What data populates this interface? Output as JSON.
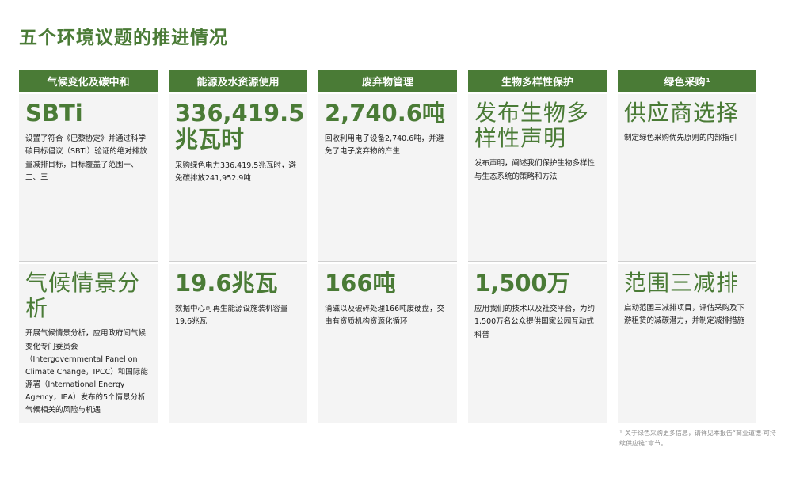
{
  "title": "五个环境议题的推进情况",
  "columns": [
    {
      "header": "气候变化及碳中和",
      "top": {
        "metric": "SBTi",
        "desc": "设置了符合《巴黎协定》并通过科学碳目标倡议（SBTi）验证的绝对排放量减排目标，目标覆盖了范围一、二、三"
      },
      "bottom": {
        "metric": "气候情景分析",
        "desc": "开展气候情景分析，应用政府间气候变化专门委员会（Intergovernmental Panel on Climate Change，IPCC）和国际能源署（International Energy Agency，IEA）发布的5个情景分析气候相关的风险与机遇"
      }
    },
    {
      "header": "能源及水资源使用",
      "top": {
        "metric": "336,419.5兆瓦时",
        "desc": "采购绿色电力336,419.5兆瓦时，避免碳排放241,952.9吨"
      },
      "bottom": {
        "metric": "19.6兆瓦",
        "desc": "数据中心可再生能源设施装机容量19.6兆瓦"
      }
    },
    {
      "header": "废弃物管理",
      "top": {
        "metric": "2,740.6吨",
        "desc": "回收利用电子设备2,740.6吨，并避免了电子废弃物的产生"
      },
      "bottom": {
        "metric": "166吨",
        "desc": "消磁以及破碎处理166吨废硬盘，交由有资质机构资源化循环"
      }
    },
    {
      "header": "生物多样性保护",
      "top": {
        "metric": "发布生物多样性声明",
        "desc": "发布声明，阐述我们保护生物多样性与生态系统的策略和方法"
      },
      "bottom": {
        "metric": "1,500万",
        "desc": "应用我们的技术以及社交平台，为约1,500万名公众提供国家公园互动式科普"
      }
    },
    {
      "header": "绿色采购",
      "header_sup": "1",
      "top": {
        "metric": "供应商选择",
        "desc": "制定绿色采购优先原则的内部指引"
      },
      "bottom": {
        "metric": "范围三减排",
        "desc": "启动范围三减排项目，评估采购及下游租赁的减碳潜力，并制定减排措施"
      }
    }
  ],
  "footnote": {
    "mark": "1",
    "text": "关于绿色采购更多信息，请详见本报告“商业道德-可持续供应链”章节。"
  },
  "colors": {
    "accent": "#4a7b36",
    "cell_bg": "#f4f4f4"
  }
}
